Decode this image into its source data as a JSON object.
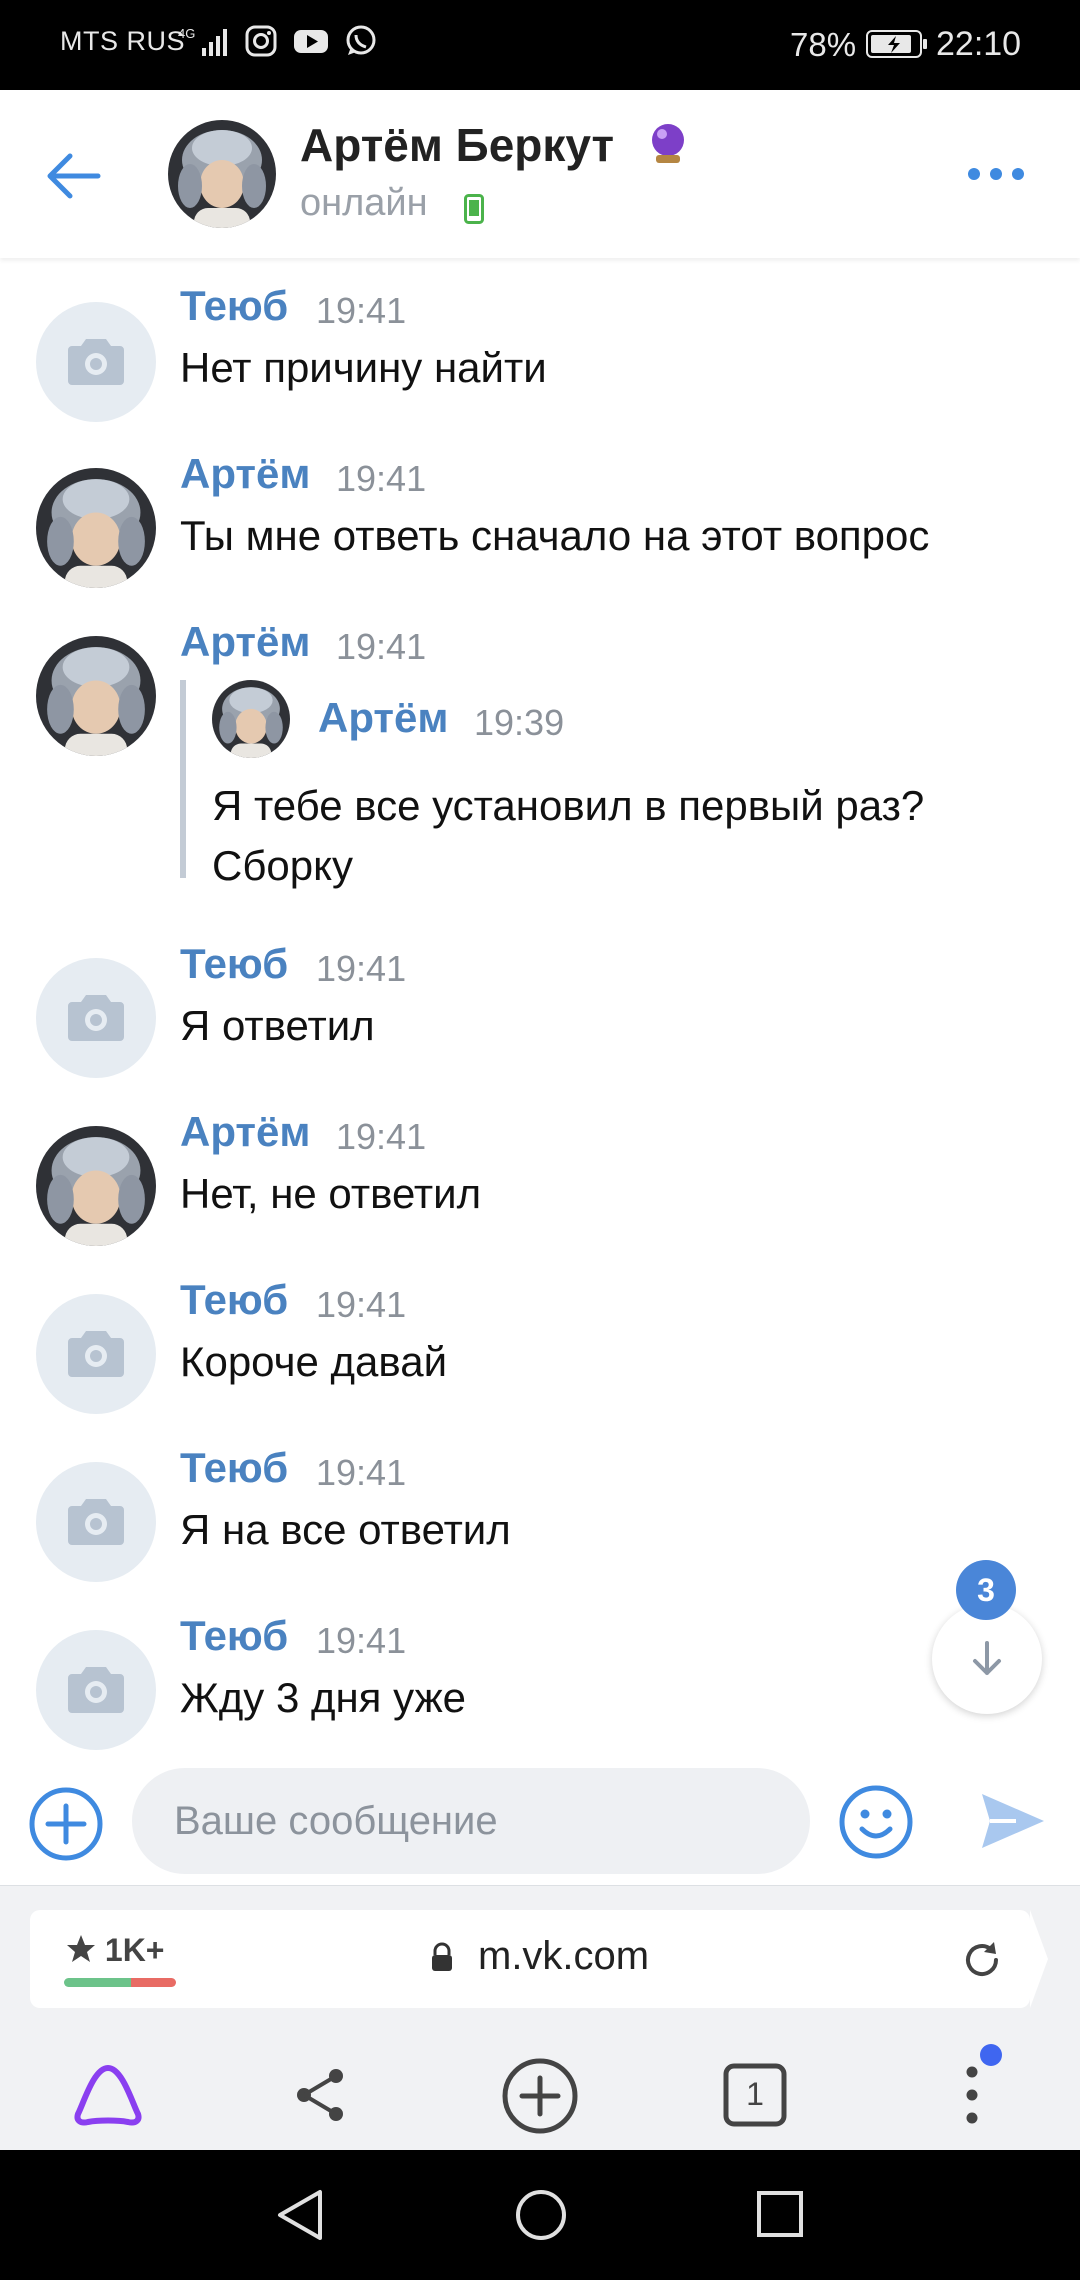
{
  "status_bar": {
    "carrier": "MTS RUS",
    "network": "4G",
    "battery_percent": "78%",
    "time": "22:10"
  },
  "header": {
    "contact_name": "Артём Беркут",
    "status": "онлайн",
    "back_icon": "arrow-left-icon",
    "more_icon": "more-dots-icon"
  },
  "messages": [
    {
      "sender": "Теюб",
      "time": "19:41",
      "text": "Нет причину найти",
      "avatar": "placeholder"
    },
    {
      "sender": "Артём",
      "time": "19:41",
      "text": "Ты мне ответь сначало на этот вопрос",
      "avatar": "photo"
    },
    {
      "sender": "Артём",
      "time": "19:41",
      "avatar": "photo",
      "reply": {
        "sender": "Артём",
        "time": "19:39",
        "text": "Я тебе все установил в первый раз? Сборку"
      }
    },
    {
      "sender": "Теюб",
      "time": "19:41",
      "text": "Я ответил",
      "avatar": "placeholder"
    },
    {
      "sender": "Артём",
      "time": "19:41",
      "text": "Нет, не ответил",
      "avatar": "photo"
    },
    {
      "sender": "Теюб",
      "time": "19:41",
      "text": "Короче давай",
      "avatar": "placeholder"
    },
    {
      "sender": "Теюб",
      "time": "19:41",
      "text": "Я на все ответил",
      "avatar": "placeholder"
    },
    {
      "sender": "Теюб",
      "time": "19:41",
      "text": "Жду 3 дня уже",
      "avatar": "placeholder"
    }
  ],
  "scroll_down": {
    "unread_count": "3"
  },
  "composer": {
    "placeholder": "Ваше сообщение"
  },
  "browser": {
    "rating": "1K+",
    "url": "m.vk.com",
    "tab_count": "1"
  },
  "colors": {
    "accent": "#4a82c0",
    "unread_badge": "#4a86d8",
    "send_icon": "#a9c8ef",
    "alice_purple": "#8a3ff0"
  }
}
